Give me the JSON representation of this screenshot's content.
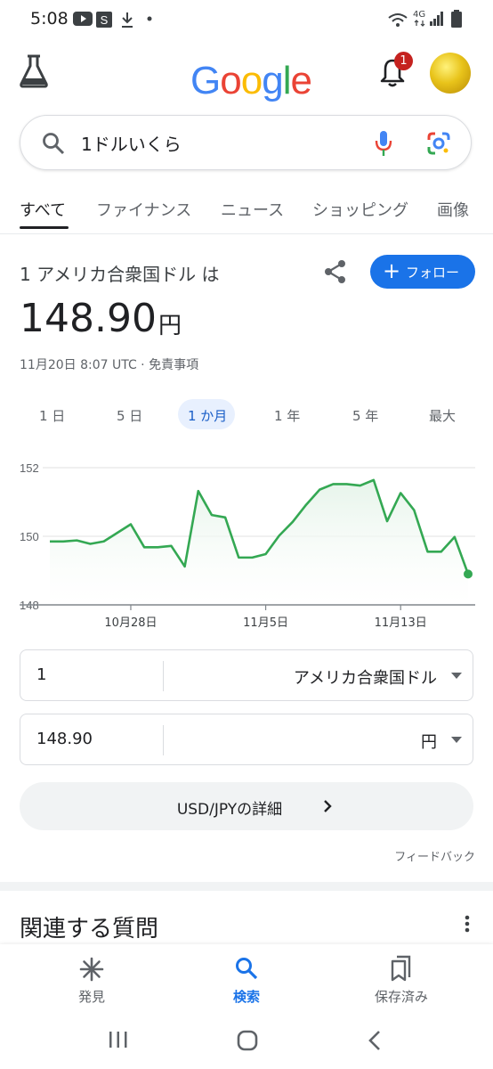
{
  "status_bar": {
    "time": "5:08",
    "network": "4G",
    "icons": [
      "youtube-icon",
      "s-app-icon",
      "download-icon",
      "dot-icon",
      "wifi-icon",
      "signal-icon",
      "battery-icon"
    ]
  },
  "header": {
    "logo_text": "Google",
    "notification_count": "1",
    "icons": [
      "labs-flask-icon",
      "bell-icon",
      "avatar"
    ]
  },
  "search": {
    "query": "1ドルいくら",
    "icons": [
      "search-icon",
      "mic-icon",
      "lens-icon"
    ]
  },
  "tabs": [
    {
      "label": "すべて",
      "active": true
    },
    {
      "label": "ファイナンス",
      "active": false
    },
    {
      "label": "ニュース",
      "active": false
    },
    {
      "label": "ショッピング",
      "active": false
    },
    {
      "label": "画像",
      "active": false
    }
  ],
  "finance": {
    "conversion_label": "1 アメリカ合衆国ドル は",
    "follow_label": "フォロー",
    "rate_value": "148.90",
    "rate_unit": "円",
    "timestamp": "11月20日 8:07 UTC · 免責事項",
    "ranges": [
      {
        "label": "1 日",
        "active": false
      },
      {
        "label": "5 日",
        "active": false
      },
      {
        "label": "1 か月",
        "active": true
      },
      {
        "label": "1 年",
        "active": false
      },
      {
        "label": "5 年",
        "active": false
      },
      {
        "label": "最大",
        "active": false
      }
    ]
  },
  "chart_data": {
    "type": "line",
    "y_ticks": [
      "152",
      "150",
      "148"
    ],
    "ylim": [
      148,
      152
    ],
    "x_tick_labels": [
      "10月28日",
      "11月5日",
      "11月13日"
    ],
    "x_tick_index": [
      6,
      16,
      26
    ],
    "values": [
      149.85,
      149.85,
      149.88,
      149.78,
      149.85,
      150.1,
      150.35,
      149.68,
      149.68,
      149.72,
      149.12,
      151.32,
      150.62,
      150.55,
      149.38,
      149.38,
      149.48,
      150.02,
      150.42,
      150.92,
      151.36,
      151.52,
      151.52,
      151.48,
      151.64,
      150.44,
      151.26,
      150.76,
      149.55,
      149.55,
      149.98,
      148.9
    ],
    "line_color": "#34a853",
    "fill_color": "#e6f4ea"
  },
  "converter": {
    "from_value": "1",
    "from_currency": "アメリカ合衆国ドル",
    "to_value": "148.90",
    "to_currency": "円"
  },
  "details_label": "USD/JPYの詳細",
  "feedback_label": "フィードバック",
  "related_title": "関連する質問",
  "bottom_nav": [
    {
      "label": "発見",
      "icon": "discover-icon",
      "active": false
    },
    {
      "label": "検索",
      "icon": "search-icon",
      "active": true
    },
    {
      "label": "保存済み",
      "icon": "saved-icon",
      "active": false
    }
  ],
  "system_nav": [
    "recents-icon",
    "home-icon",
    "back-icon"
  ]
}
